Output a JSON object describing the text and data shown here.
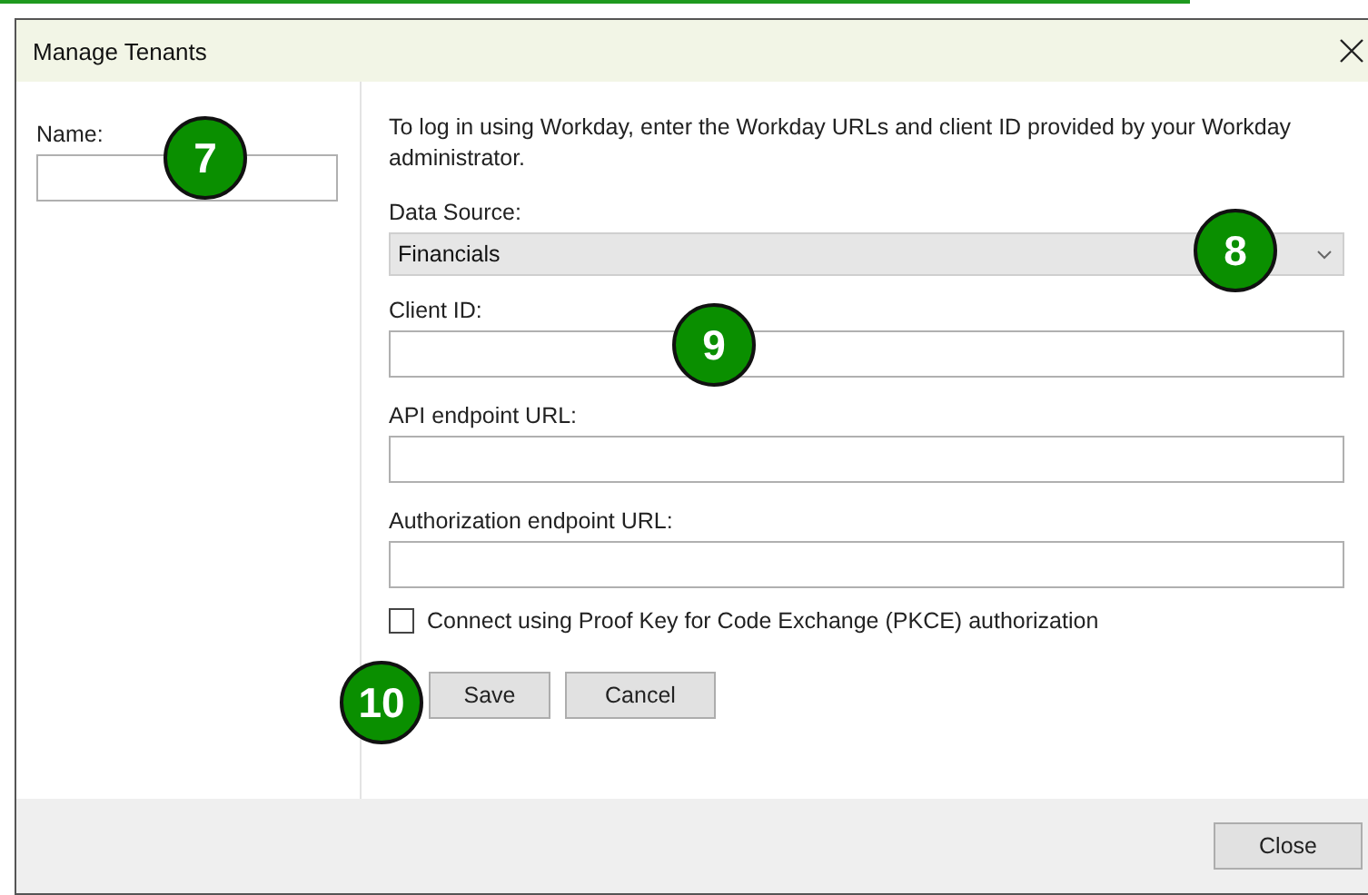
{
  "window": {
    "title": "Manage Tenants"
  },
  "name_field": {
    "label": "Name:"
  },
  "intro": "To log in using Workday, enter the Workday URLs and client ID provided by your Workday administrator.",
  "data_source": {
    "label": "Data Source:",
    "value": "Financials"
  },
  "fields": [
    {
      "label": "Client ID:"
    },
    {
      "label": "API endpoint URL:"
    },
    {
      "label": "Authorization endpoint URL:"
    }
  ],
  "pkce": {
    "label": "Connect using Proof Key for Code Exchange (PKCE) authorization",
    "checked": false
  },
  "buttons": [
    "Save",
    "Cancel"
  ],
  "footer_button": "Close",
  "callouts": [
    {
      "label": "7"
    },
    {
      "label": "8"
    },
    {
      "label": "9"
    },
    {
      "label": "10"
    }
  ]
}
